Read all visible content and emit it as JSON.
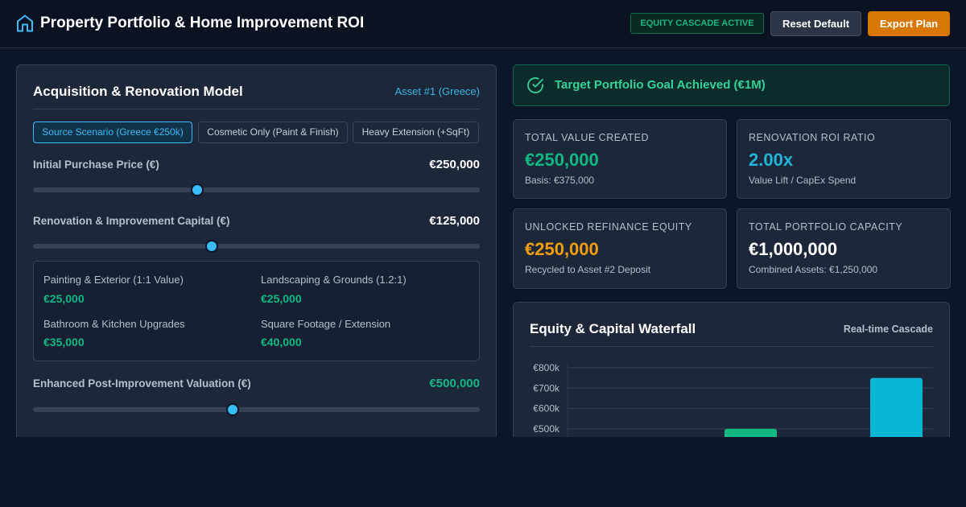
{
  "header": {
    "title": "Property Portfolio & Home Improvement ROI",
    "badge": "EQUITY CASCADE ACTIVE",
    "reset_label": "Reset Default",
    "export_label": "Export Plan",
    "icon": "home-icon"
  },
  "model": {
    "title": "Acquisition & Renovation Model",
    "asset_label": "Asset #1 (Greece)",
    "scenarios": [
      {
        "label": "Source Scenario (Greece €250k)",
        "active": true
      },
      {
        "label": "Cosmetic Only (Paint & Finish)",
        "active": false
      },
      {
        "label": "Heavy Extension (+SqFt)",
        "active": false
      }
    ],
    "purchase": {
      "label": "Initial Purchase Price (€)",
      "value": "€250,000",
      "slider_fraction": 0.368
    },
    "renovation": {
      "label": "Renovation & Improvement Capital (€)",
      "value": "€125,000",
      "slider_fraction": 0.4
    },
    "breakdown": [
      {
        "label": "Painting & Exterior (1:1 Value)",
        "value": "€25,000"
      },
      {
        "label": "Landscaping & Grounds (1.2:1)",
        "value": "€25,000"
      },
      {
        "label": "Bathroom & Kitchen Upgrades",
        "value": "€35,000"
      },
      {
        "label": "Square Footage / Extension",
        "value": "€40,000"
      }
    ],
    "valuation": {
      "label": "Enhanced Post-Improvement Valuation (€)",
      "value": "€500,000",
      "slider_fraction": 0.447
    }
  },
  "goal": {
    "text": "Target Portfolio Goal Achieved (€1M)",
    "icon": "check-circle-icon"
  },
  "stats": [
    {
      "label": "TOTAL VALUE CREATED",
      "value": "€250,000",
      "sub": "Basis: €375,000",
      "color": "#10b981"
    },
    {
      "label": "RENOVATION ROI RATIO",
      "value": "2.00x",
      "sub": "Value Lift / CapEx Spend",
      "color": "#22b5d8"
    },
    {
      "label": "UNLOCKED REFINANCE EQUITY",
      "value": "€250,000",
      "sub": "Recycled to Asset #2 Deposit",
      "color": "#f59e0b"
    },
    {
      "label": "TOTAL PORTFOLIO CAPACITY",
      "value": "€1,000,000",
      "sub": "Combined Assets: €1,250,000",
      "color": "#ffffff"
    }
  ],
  "waterfall": {
    "title": "Equity & Capital Waterfall",
    "subtitle": "Real-time Cascade"
  },
  "chart_data": {
    "type": "bar",
    "title": "Equity & Capital Waterfall",
    "y_tick_labels": [
      "€800k",
      "€700k",
      "€600k",
      "€500k"
    ],
    "y_ticks": [
      800,
      700,
      600,
      500
    ],
    "bars": [
      {
        "value": 500,
        "color": "#10b981"
      },
      {
        "value": 750,
        "color": "#06b6d4"
      }
    ],
    "grid": true
  }
}
